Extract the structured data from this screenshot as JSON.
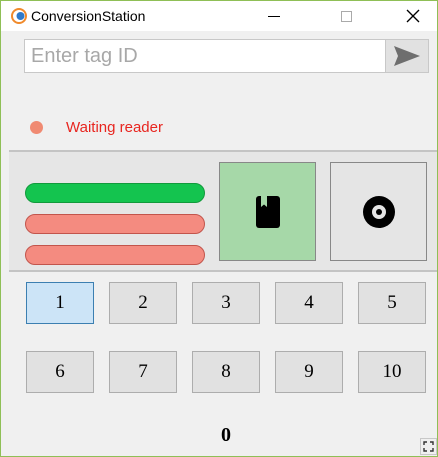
{
  "window": {
    "title": "ConversionStation",
    "minimize_icon": "minimize-icon",
    "maximize_icon": "maximize-icon",
    "close_symbol": "✕"
  },
  "tag": {
    "value": "",
    "placeholder": "Enter tag ID",
    "send_icon": "send-arrow-icon"
  },
  "status": {
    "text": "Waiting reader",
    "dot_color": "#f08a72",
    "text_color": "#e8251f"
  },
  "indicators": [
    {
      "color": "#14c44f",
      "state": "on"
    },
    {
      "color": "#f48b80",
      "state": "off"
    },
    {
      "color": "#f48b80",
      "state": "off"
    }
  ],
  "modes": [
    {
      "icon": "book-icon",
      "active": true,
      "color": "#a6d8a8"
    },
    {
      "icon": "disc-icon",
      "active": false,
      "color": "#e5e5e5"
    }
  ],
  "numbers": {
    "buttons": [
      "1",
      "2",
      "3",
      "4",
      "5",
      "6",
      "7",
      "8",
      "9",
      "10"
    ],
    "selected": "1"
  },
  "counter": "0",
  "resize_icon": "resize-grip-icon"
}
